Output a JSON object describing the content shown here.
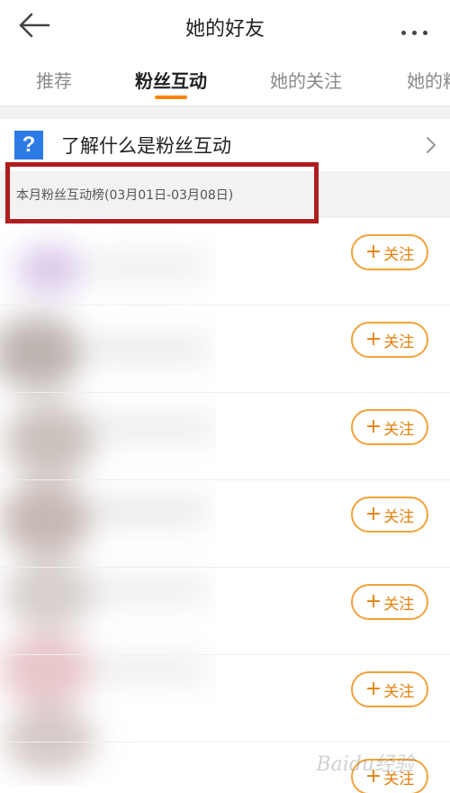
{
  "header": {
    "title": "她的好友",
    "back_icon": "arrow-left-icon",
    "more_icon": "more-dots-icon"
  },
  "tabs": [
    {
      "label": "推荐",
      "active": false
    },
    {
      "label": "粉丝互动",
      "active": true
    },
    {
      "label": "她的关注",
      "active": false
    },
    {
      "label": "她的粉",
      "active": false
    }
  ],
  "help": {
    "icon_text": "?",
    "text": "了解什么是粉丝互动"
  },
  "section": {
    "title": "本月粉丝互动榜(03月01日-03月08日)"
  },
  "rows": [
    {
      "follow_label": "关注"
    },
    {
      "follow_label": "关注"
    },
    {
      "follow_label": "关注"
    },
    {
      "follow_label": "关注"
    },
    {
      "follow_label": "关注"
    },
    {
      "follow_label": "关注"
    },
    {
      "follow_label": "关注"
    }
  ],
  "watermark": "Baidu经验",
  "colors": {
    "accent": "#ff8200",
    "follow_border": "#f2a23a",
    "help_icon_bg": "#2c7be5",
    "highlight_box": "#b01c1c"
  }
}
